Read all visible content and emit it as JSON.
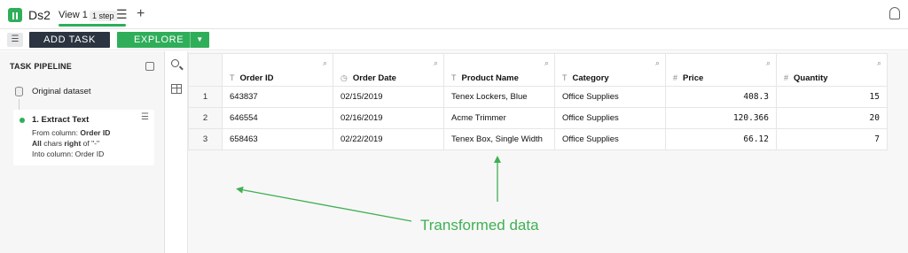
{
  "header": {
    "app_name": "Ds2",
    "view_tab": "View 1",
    "step_badge": "1 step",
    "menu_icon": "hamburger-icon",
    "add_view_icon": "plus-icon",
    "notification_icon": "bell-icon"
  },
  "toolbar": {
    "add_task_label": "ADD TASK",
    "explore_label": "EXPLORE"
  },
  "sidebar": {
    "title": "TASK PIPELINE",
    "original_label": "Original dataset",
    "step": {
      "title": "1. Extract Text",
      "line1_prefix": "From column: ",
      "line1_value": "Order ID",
      "line2_a": "All",
      "line2_b": " chars ",
      "line2_c": "right",
      "line2_d": " of \"-\"",
      "line3": "Into column: Order ID"
    }
  },
  "table": {
    "columns": [
      {
        "label": "Order ID",
        "type_icon": "T"
      },
      {
        "label": "Order Date",
        "type_icon": "◷"
      },
      {
        "label": "Product Name",
        "type_icon": "T"
      },
      {
        "label": "Category",
        "type_icon": "T"
      },
      {
        "label": "Price",
        "type_icon": "#"
      },
      {
        "label": "Quantity",
        "type_icon": "#"
      }
    ],
    "rows": [
      {
        "idx": "1",
        "cells": [
          "643837",
          "02/15/2019",
          "Tenex Lockers, Blue",
          "Office Supplies",
          "408.3",
          "15"
        ]
      },
      {
        "idx": "2",
        "cells": [
          "646554",
          "02/16/2019",
          "Acme Trimmer",
          "Office Supplies",
          "120.366",
          "20"
        ]
      },
      {
        "idx": "3",
        "cells": [
          "658463",
          "02/22/2019",
          "Tenex Box, Single Width",
          "Office Supplies",
          "66.12",
          "7"
        ]
      }
    ]
  },
  "annotation": {
    "text": "Transformed data",
    "color": "#3fb053"
  },
  "colors": {
    "accent_green": "#2fae5a",
    "dark_button": "#2b3440"
  }
}
